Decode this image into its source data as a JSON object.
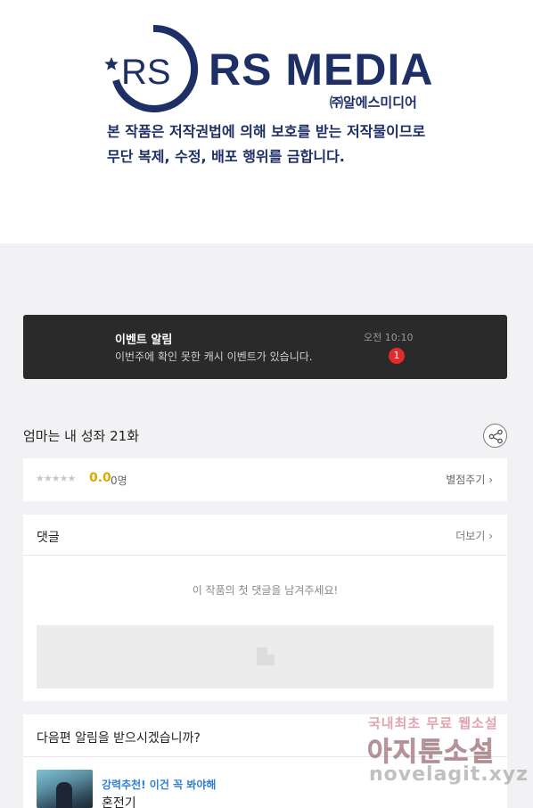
{
  "banner": {
    "brand": "RS MEDIA",
    "brand_mark": "RS",
    "brand_ko": "㈜알에스미디어",
    "notice_line1": "본 작품은 저작권법에 의해 보호를 받는 저작물이므로",
    "notice_line2": "무단 복제, 수정, 배포 행위를 금합니다."
  },
  "event": {
    "title": "이벤트 알림",
    "message": "이번주에 확인 못한 캐시 이벤트가 있습니다.",
    "time": "오전 10:10",
    "badge_count": "1"
  },
  "episode": {
    "title": "엄마는 내 성좌 21화",
    "share_icon": "share-icon"
  },
  "rating": {
    "stars": "★★★★★",
    "score": "0.0",
    "count": "0명",
    "rate_label": "별점주기 ›"
  },
  "comments": {
    "title": "댓글",
    "more_label": "더보기 ›",
    "empty_message": "이 작품의 첫 댓글을 남겨주세요!"
  },
  "next": {
    "question": "다음편 알림을 받으시겠습니까?",
    "recommend_tag": "강력추천! 이건 꼭 봐야해",
    "recommend_title": "혼전기"
  },
  "watermark": {
    "line1": "국내최초 무료 웹소설",
    "line2": "아지툰소설",
    "line3": "novelagit.xyz"
  },
  "colors": {
    "brand_navy": "#1e2f66",
    "event_bg": "#2a2a2a",
    "badge_red": "#e02b2b",
    "score_gold": "#e0a800",
    "link_blue": "#2f7fd8"
  }
}
